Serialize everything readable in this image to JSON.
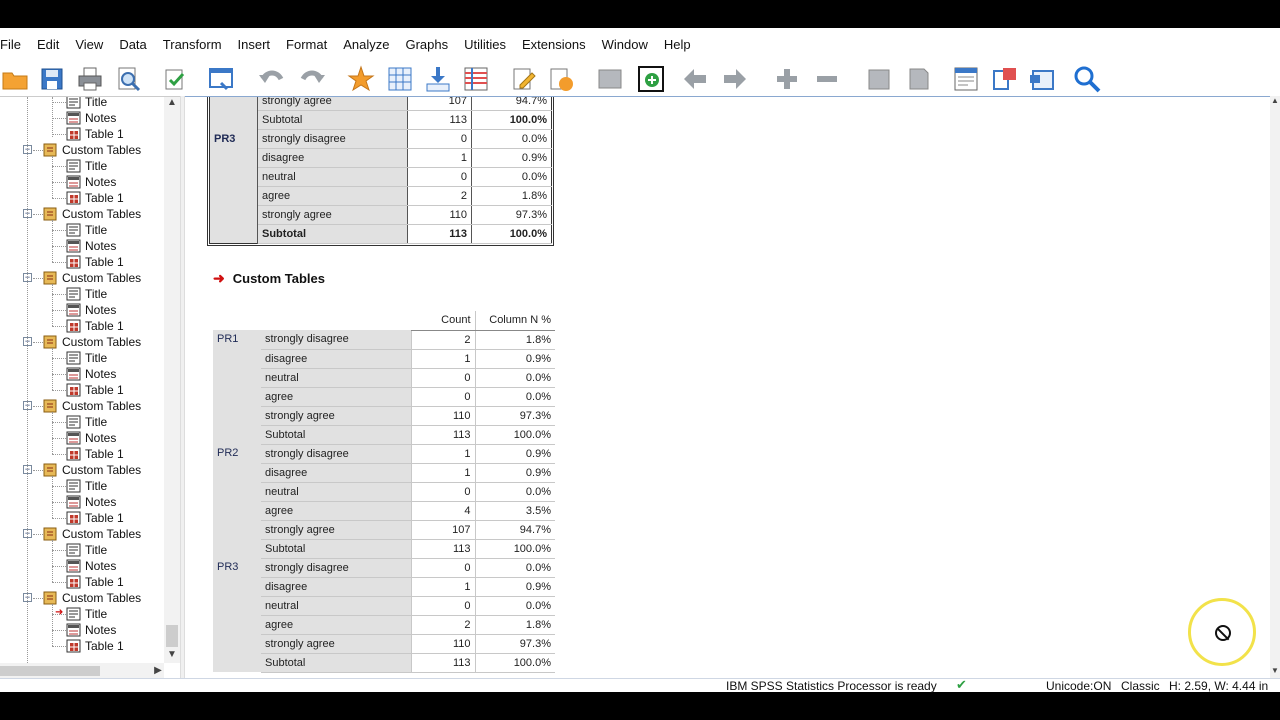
{
  "menu": [
    "File",
    "Edit",
    "View",
    "Data",
    "Transform",
    "Insert",
    "Format",
    "Analyze",
    "Graphs",
    "Utilities",
    "Extensions",
    "Window",
    "Help"
  ],
  "outline": {
    "groups": [
      {
        "label": "Custom Tables",
        "children": [
          "Title",
          "Notes",
          "Table 1"
        ]
      },
      {
        "label": "Custom Tables",
        "children": [
          "Title",
          "Notes",
          "Table 1"
        ]
      },
      {
        "label": "Custom Tables",
        "children": [
          "Title",
          "Notes",
          "Table 1"
        ]
      },
      {
        "label": "Custom Tables",
        "children": [
          "Title",
          "Notes",
          "Table 1"
        ]
      },
      {
        "label": "Custom Tables",
        "children": [
          "Title",
          "Notes",
          "Table 1"
        ]
      },
      {
        "label": "Custom Tables",
        "children": [
          "Title",
          "Notes",
          "Table 1"
        ]
      },
      {
        "label": "Custom Tables",
        "children": [
          "Title",
          "Notes",
          "Table 1"
        ]
      },
      {
        "label": "Custom Tables",
        "children": [
          "Title",
          "Notes",
          "Table 1"
        ]
      }
    ],
    "top_children": [
      "Title",
      "Notes",
      "Table 1"
    ]
  },
  "top_table": {
    "partial_rows": [
      {
        "cat": "strongly agree",
        "count": "107",
        "pct": "94.7%"
      },
      {
        "cat": "Subtotal",
        "count": "113",
        "pct": "100.0%"
      }
    ],
    "group": {
      "var": "PR3",
      "rows": [
        {
          "cat": "strongly disagree",
          "count": "0",
          "pct": "0.0%"
        },
        {
          "cat": "disagree",
          "count": "1",
          "pct": "0.9%"
        },
        {
          "cat": "neutral",
          "count": "0",
          "pct": "0.0%"
        },
        {
          "cat": "agree",
          "count": "2",
          "pct": "1.8%"
        },
        {
          "cat": "strongly agree",
          "count": "110",
          "pct": "97.3%"
        },
        {
          "cat": "Subtotal",
          "count": "113",
          "pct": "100.0%"
        }
      ]
    }
  },
  "section_title": "Custom Tables",
  "main_table": {
    "headers": [
      "Count",
      "Column N %"
    ],
    "groups": [
      {
        "var": "PR1",
        "rows": [
          {
            "cat": "strongly disagree",
            "count": "2",
            "pct": "1.8%"
          },
          {
            "cat": "disagree",
            "count": "1",
            "pct": "0.9%"
          },
          {
            "cat": "neutral",
            "count": "0",
            "pct": "0.0%"
          },
          {
            "cat": "agree",
            "count": "0",
            "pct": "0.0%"
          },
          {
            "cat": "strongly agree",
            "count": "110",
            "pct": "97.3%"
          },
          {
            "cat": "Subtotal",
            "count": "113",
            "pct": "100.0%"
          }
        ]
      },
      {
        "var": "PR2",
        "rows": [
          {
            "cat": "strongly disagree",
            "count": "1",
            "pct": "0.9%"
          },
          {
            "cat": "disagree",
            "count": "1",
            "pct": "0.9%"
          },
          {
            "cat": "neutral",
            "count": "0",
            "pct": "0.0%"
          },
          {
            "cat": "agree",
            "count": "4",
            "pct": "3.5%"
          },
          {
            "cat": "strongly agree",
            "count": "107",
            "pct": "94.7%"
          },
          {
            "cat": "Subtotal",
            "count": "113",
            "pct": "100.0%"
          }
        ]
      },
      {
        "var": "PR3",
        "rows": [
          {
            "cat": "strongly disagree",
            "count": "0",
            "pct": "0.0%"
          },
          {
            "cat": "disagree",
            "count": "1",
            "pct": "0.9%"
          },
          {
            "cat": "neutral",
            "count": "0",
            "pct": "0.0%"
          },
          {
            "cat": "agree",
            "count": "2",
            "pct": "1.8%"
          },
          {
            "cat": "strongly agree",
            "count": "110",
            "pct": "97.3%"
          },
          {
            "cat": "Subtotal",
            "count": "113",
            "pct": "100.0%"
          }
        ]
      }
    ]
  },
  "status": {
    "processor": "IBM SPSS Statistics Processor is ready",
    "encoding": "Unicode:ON",
    "mode": "Classic",
    "dims": "H: 2.59, W: 4.44 in"
  },
  "colors": {
    "accent": "#1f6fd1",
    "var_text": "#1f2a55",
    "header_arrow": "#d01010"
  }
}
